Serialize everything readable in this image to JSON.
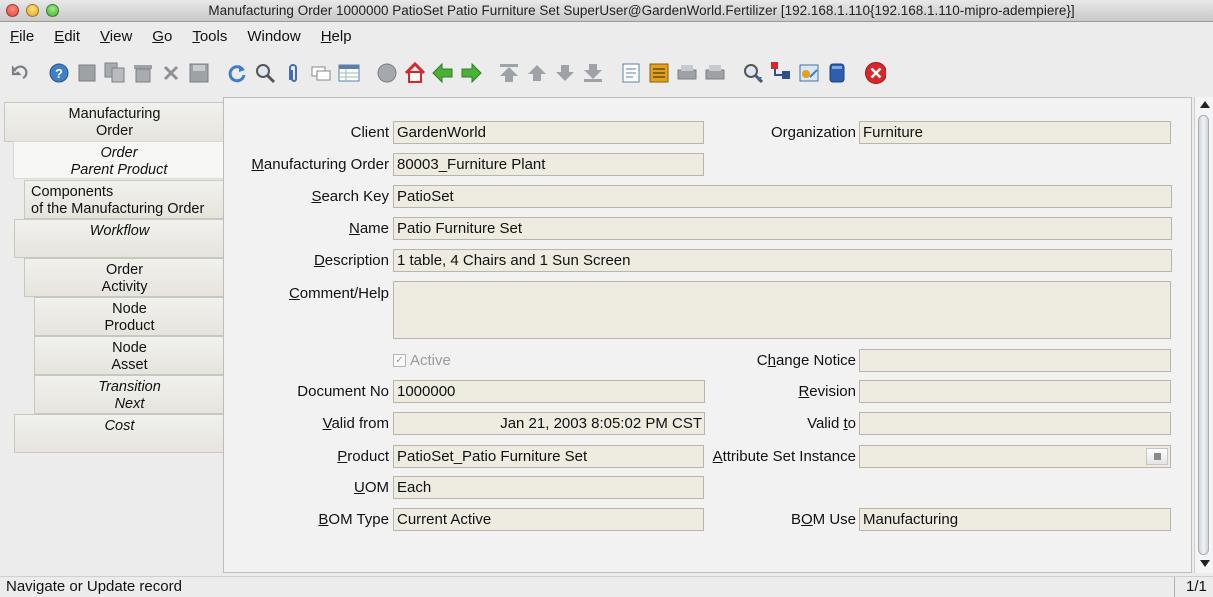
{
  "window": {
    "title": "Manufacturing Order  1000000  PatioSet  Patio Furniture Set  SuperUser@GardenWorld.Fertilizer [192.168.1.110{192.168.1.110-mipro-adempiere}]"
  },
  "menu": [
    "File",
    "Edit",
    "View",
    "Go",
    "Tools",
    "Window",
    "Help"
  ],
  "toolbar": {
    "icons": [
      "undo-icon",
      "help-icon",
      "new-record-icon",
      "copy-record-icon",
      "delete-icon",
      "delete-selection-icon",
      "save-icon",
      "refresh-icon",
      "find-icon",
      "attachment-icon",
      "chat-icon",
      "grid-toggle-icon",
      "history-icon",
      "home-icon",
      "parent-record-icon",
      "detail-record-icon",
      "first-record-icon",
      "previous-record-icon",
      "next-record-icon",
      "last-record-icon",
      "report-icon",
      "archive-icon",
      "print-preview-icon",
      "print-icon",
      "zoom-across-icon",
      "workflow-icon",
      "request-icon",
      "product-info-icon",
      "end-window-icon"
    ]
  },
  "tabs": [
    {
      "lines": [
        "Manufacturing",
        "Order"
      ]
    },
    {
      "lines": [
        "Order",
        "Parent Product"
      ]
    },
    {
      "lines": [
        "Components",
        "of the Manufacturing Order"
      ]
    },
    {
      "lines": [
        "Workflow"
      ]
    },
    {
      "lines": [
        "Order",
        "Activity"
      ]
    },
    {
      "lines": [
        "Node",
        "Product"
      ]
    },
    {
      "lines": [
        "Node",
        "Asset"
      ]
    },
    {
      "lines": [
        "Transition",
        "Next"
      ]
    },
    {
      "lines": [
        "Cost"
      ]
    }
  ],
  "form": {
    "client": {
      "label": "Client",
      "value": "GardenWorld"
    },
    "organization": {
      "label": "Organization",
      "value": "Furniture"
    },
    "manufacturing_order": {
      "label_u": "M",
      "label_rest": "anufacturing Order",
      "value": "80003_Furniture Plant"
    },
    "search_key": {
      "label_pre": "",
      "label_u": "S",
      "label_rest": "earch Key",
      "value": "PatioSet"
    },
    "name": {
      "label_u": "N",
      "label_rest": "ame",
      "value": "Patio Furniture Set"
    },
    "description": {
      "label_u": "D",
      "label_rest": "escription",
      "value": "1 table, 4 Chairs and 1 Sun Screen"
    },
    "comment_help": {
      "label_u": "C",
      "label_rest": "omment/Help",
      "value": ""
    },
    "active": {
      "label": "Active",
      "checked": true
    },
    "change_notice": {
      "label_pre": "C",
      "label_u": "h",
      "label_rest": "ange Notice",
      "value": ""
    },
    "document_no": {
      "label": "Document No",
      "value": "1000000"
    },
    "revision": {
      "label_u": "R",
      "label_rest": "evision",
      "value": ""
    },
    "valid_from": {
      "label_u": "V",
      "label_rest": "alid from",
      "value": "Jan 21, 2003 8:05:02 PM CST"
    },
    "valid_to": {
      "label_pre": "Valid ",
      "label_u": "t",
      "label_rest": "o",
      "value": ""
    },
    "product": {
      "label_u": "P",
      "label_rest": "roduct",
      "value": "PatioSet_Patio Furniture Set"
    },
    "attribute_set_instance": {
      "label_u": "A",
      "label_rest": "ttribute Set Instance",
      "value": ""
    },
    "uom": {
      "label_u": "U",
      "label_rest": "OM",
      "value": "Each"
    },
    "bom_type": {
      "label_u": "B",
      "label_rest": "OM Type",
      "value": "Current Active"
    },
    "bom_use": {
      "label_pre": "B",
      "label_u": "O",
      "label_rest": "M Use",
      "value": "Manufacturing"
    }
  },
  "status": {
    "message": "Navigate or Update record",
    "record_count": "1/1"
  },
  "colors": {
    "field_bg": "#eeebe0",
    "panel_bg": "#f2f2f2",
    "delete_red": "#d8262a"
  }
}
